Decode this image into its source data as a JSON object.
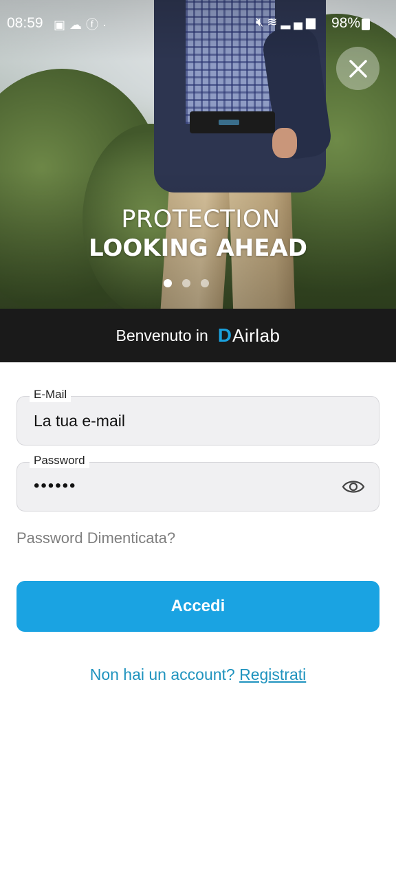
{
  "status_bar": {
    "time": "08:59",
    "battery": "98%",
    "icons_left": [
      "image-icon",
      "cloud-icon",
      "facebook-icon",
      "dot-icon"
    ],
    "icons_right": [
      "mute-icon",
      "wifi-icon",
      "volte-icon",
      "signal-icon",
      "battery-icon"
    ]
  },
  "hero": {
    "line1": "PROTECTION",
    "line2": "LOOKING AHEAD",
    "carousel_page": 1,
    "carousel_total": 3
  },
  "welcome": {
    "text": "Benvenuto in",
    "brand_mark": "D",
    "brand_name": "Airlab"
  },
  "form": {
    "email": {
      "label": "E-Mail",
      "placeholder": "La tua e-mail"
    },
    "password": {
      "label": "Password",
      "value": "••••••"
    },
    "forgot": "Password Dimenticata?",
    "login_button": "Accedi",
    "no_account": "Non hai un account?",
    "register": "Registrati"
  },
  "colors": {
    "accent": "#1aa3e2",
    "link": "#1f93be",
    "welcome_bar": "#1a1a1a",
    "field_bg": "#f0f0f2"
  }
}
